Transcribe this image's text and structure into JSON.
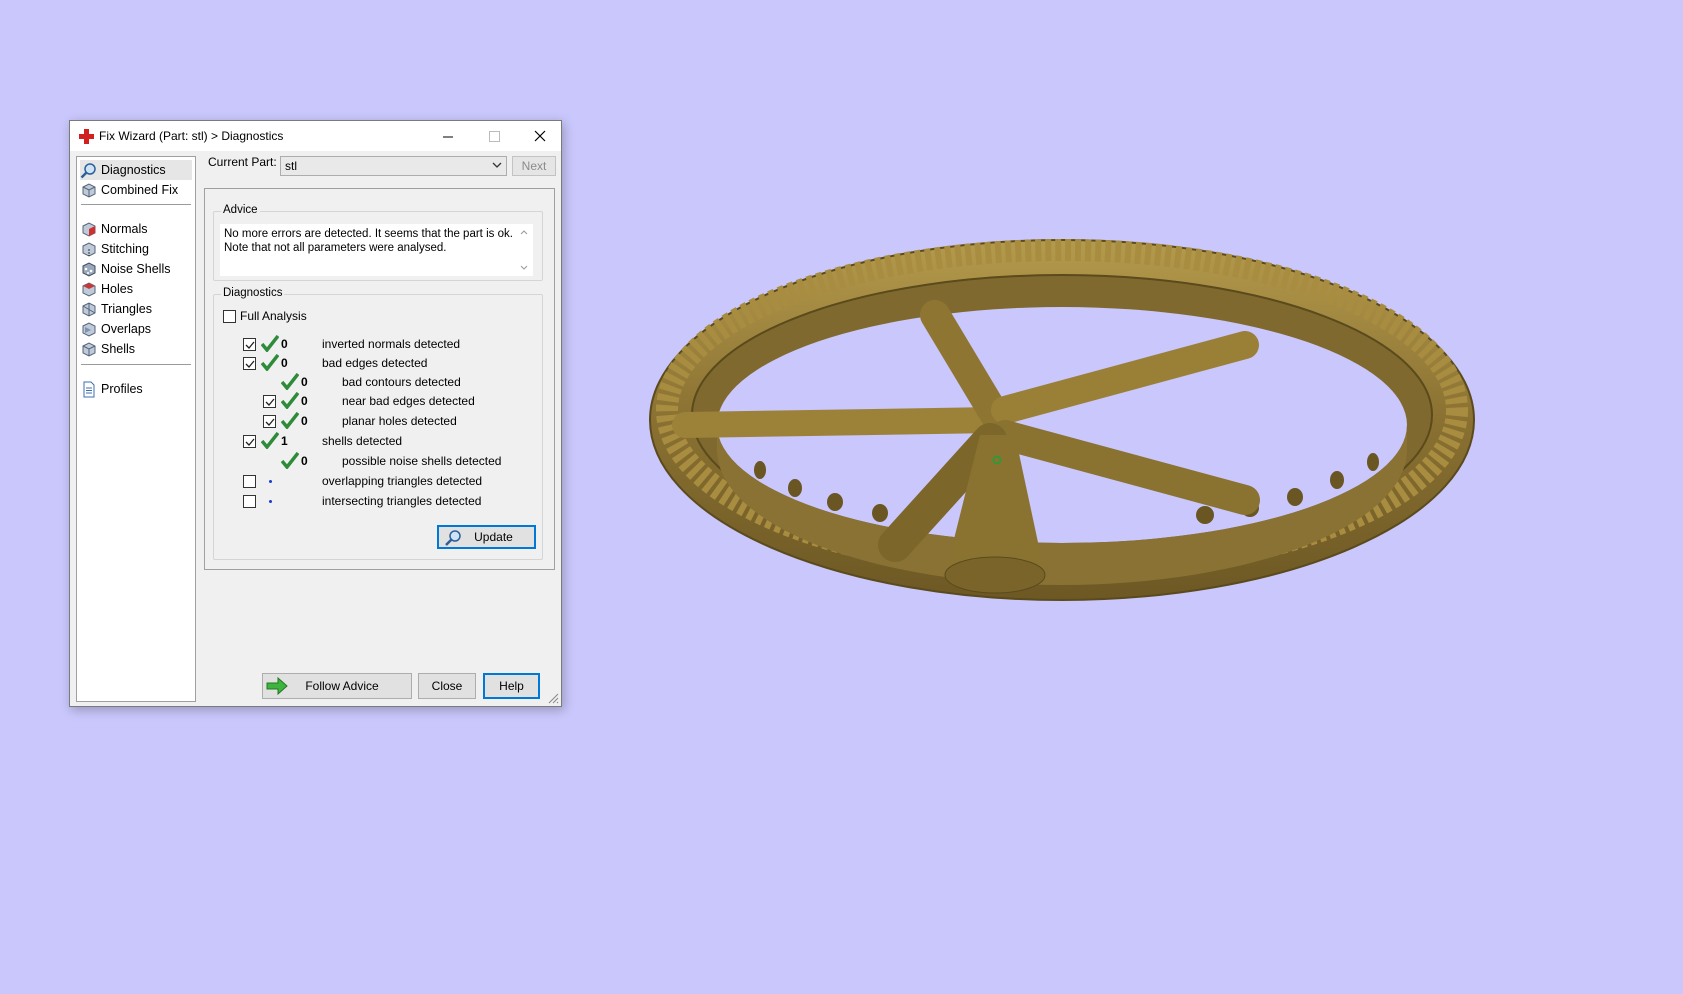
{
  "window": {
    "title": "Fix Wizard (Part: stl) > Diagnostics",
    "controls": {
      "minimize": "—",
      "maximize": "☐",
      "close": "✕"
    }
  },
  "nav": {
    "items": [
      {
        "label": "Diagnostics",
        "icon": "magnifier-icon",
        "active": true
      },
      {
        "label": "Combined Fix",
        "icon": "cube-icon"
      },
      {
        "label": "Normals",
        "icon": "normals-cube-icon"
      },
      {
        "label": "Stitching",
        "icon": "stitching-cube-icon"
      },
      {
        "label": "Noise Shells",
        "icon": "noise-shells-icon"
      },
      {
        "label": "Holes",
        "icon": "holes-cube-icon"
      },
      {
        "label": "Triangles",
        "icon": "triangles-cube-icon"
      },
      {
        "label": "Overlaps",
        "icon": "overlaps-cube-icon"
      },
      {
        "label": "Shells",
        "icon": "shells-cube-icon"
      },
      {
        "label": "Profiles",
        "icon": "document-icon"
      }
    ]
  },
  "current_part": {
    "label": "Current Part:",
    "value": "stl"
  },
  "buttons": {
    "next": "Next",
    "update": "Update",
    "follow_advice": "Follow Advice",
    "close": "Close",
    "help": "Help"
  },
  "advice": {
    "title": "Advice",
    "line1": "No more errors are detected. It seems that the part is ok.",
    "line2": "Note that not all parameters were analysed."
  },
  "diagnostics": {
    "title": "Diagnostics",
    "full_analysis": {
      "label": "Full Analysis",
      "checked": false
    },
    "rows": [
      {
        "label": "inverted normals detected",
        "count": "0",
        "checked": true,
        "status": "ok"
      },
      {
        "label": "bad edges detected",
        "count": "0",
        "checked": true,
        "status": "ok"
      },
      {
        "label": "bad contours detected",
        "count": "0",
        "status": "ok"
      },
      {
        "label": "near bad edges detected",
        "count": "0",
        "checked": true,
        "status": "ok"
      },
      {
        "label": "planar holes detected",
        "count": "0",
        "checked": true,
        "status": "ok"
      },
      {
        "label": "shells detected",
        "count": "1",
        "checked": true,
        "status": "ok"
      },
      {
        "label": "possible noise shells detected",
        "count": "0",
        "status": "ok"
      },
      {
        "label": "overlapping triangles detected",
        "checked": false,
        "status": "not-analysed"
      },
      {
        "label": "intersecting triangles detected",
        "checked": false,
        "status": "not-analysed"
      }
    ]
  },
  "colors": {
    "viewport_background": "#c9c7fb",
    "model_gold": "#8f7630",
    "check_green": "#2e8b3a",
    "focus_blue": "#0078d7"
  }
}
